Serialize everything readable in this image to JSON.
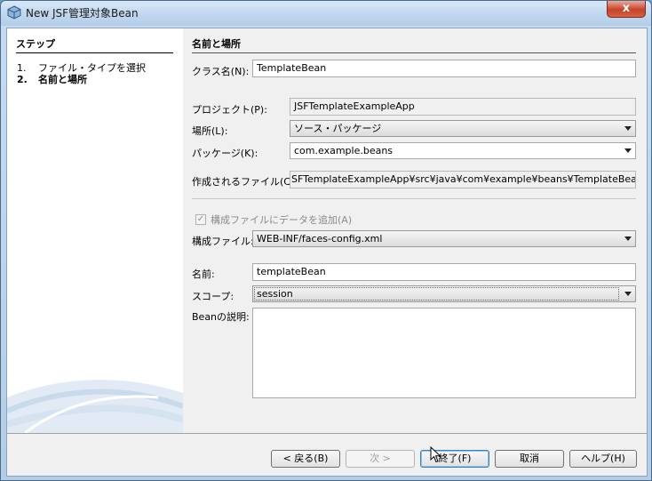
{
  "window": {
    "title": "New JSF管理対象Bean",
    "close_label": "x"
  },
  "steps": {
    "title": "ステップ",
    "items": [
      {
        "num": "1.",
        "label": "ファイル・タイプを選択"
      },
      {
        "num": "2.",
        "label": "名前と場所"
      }
    ]
  },
  "form": {
    "title": "名前と場所",
    "class_name": {
      "label": "クラス名(N):",
      "value": "TemplateBean"
    },
    "project": {
      "label": "プロジェクト(P):",
      "value": "JSFTemplateExampleApp"
    },
    "location": {
      "label": "場所(L):",
      "value": "ソース・パッケージ"
    },
    "package": {
      "label": "パッケージ(K):",
      "value": "com.example.beans"
    },
    "created_file": {
      "label": "作成されるファイル(C):",
      "value": "SFTemplateExampleApp¥src¥java¥com¥example¥beans¥TemplateBean.java"
    },
    "add_to_config": {
      "label": "構成ファイルにデータを追加(A)",
      "checked": "✓"
    },
    "config_file": {
      "label": "構成ファイル:",
      "value": "WEB-INF/faces-config.xml"
    },
    "name": {
      "label": "名前:",
      "value": "templateBean"
    },
    "scope": {
      "label": "スコープ:",
      "value": "session"
    },
    "description": {
      "label": "Beanの説明:",
      "value": ""
    }
  },
  "buttons": {
    "back": "< 戻る(B)",
    "next": "次 >",
    "finish": "終了(F)",
    "cancel": "取消",
    "help": "ヘルプ(H)"
  }
}
